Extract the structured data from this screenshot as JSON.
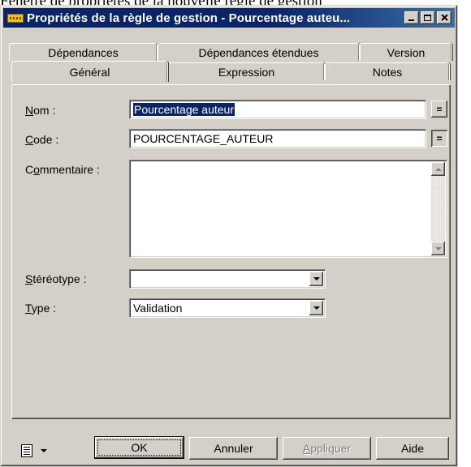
{
  "background_text": "Fenêtre de propriétés de la nouvelle règle de gestion",
  "window": {
    "title": "Propriétés de la règle de gestion - Pourcentage auteu...",
    "controls": [
      "minimize-icon",
      "maximize-icon",
      "close-icon"
    ],
    "title_color": "#0a246a"
  },
  "tabs": {
    "back_row": [
      "Dépendances",
      "Dépendances étendues",
      "Version"
    ],
    "front_row": [
      "Général",
      "Expression",
      "Notes"
    ],
    "selected": "Général"
  },
  "form": {
    "nom": {
      "label_underline": "N",
      "label_rest": "om :",
      "value": "Pourcentage auteur",
      "button": "="
    },
    "code": {
      "label_underline": "C",
      "label_rest": "ode :",
      "value": "POURCENTAGE_AUTEUR",
      "button": "="
    },
    "commentaire": {
      "label_pre": "C",
      "label_underline": "o",
      "label_rest": "mmentaire :",
      "value": ""
    },
    "stereotype": {
      "label_underline": "S",
      "label_rest": "téréotype :",
      "value": ""
    },
    "type": {
      "label_underline": "T",
      "label_rest": "ype :",
      "value": "Validation"
    }
  },
  "buttons": {
    "ok": "OK",
    "cancel": "Annuler",
    "apply_underline": "A",
    "apply_rest": "ppliquer",
    "help": "Aide"
  },
  "menu_icon": "list-menu-icon"
}
